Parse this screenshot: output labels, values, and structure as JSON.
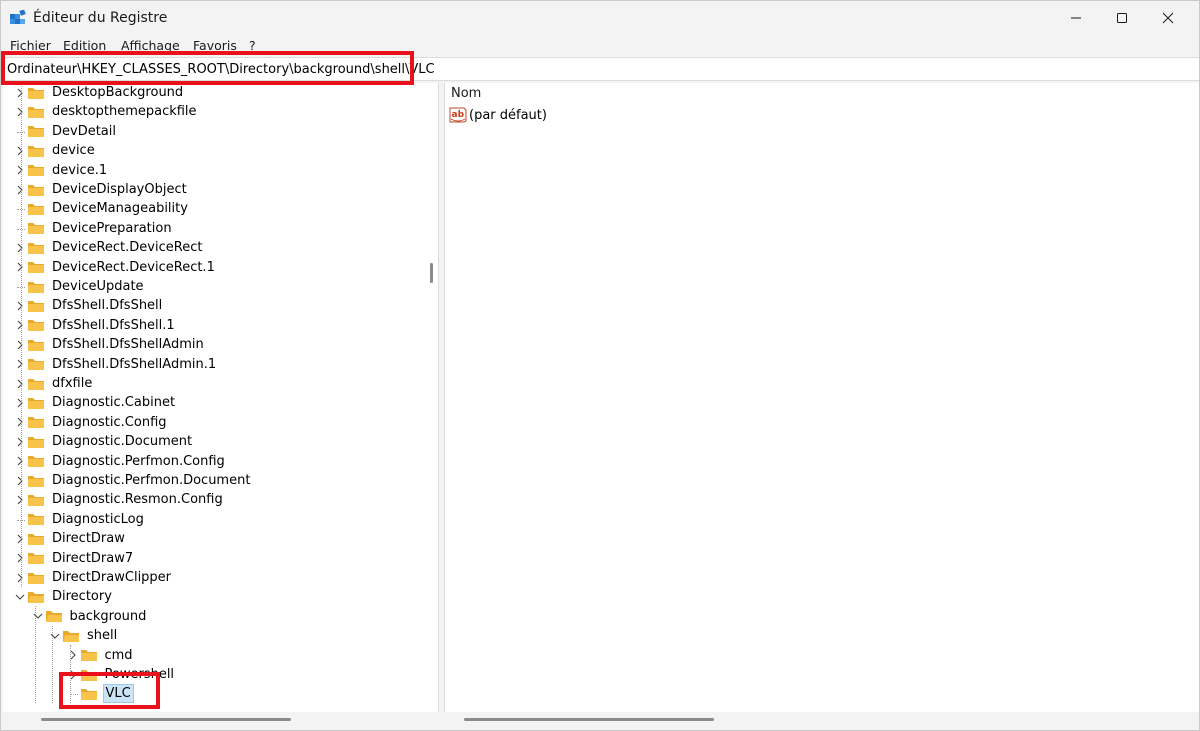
{
  "window": {
    "title": "Éditeur du Registre",
    "icons": {
      "app": "registry-editor-icon",
      "minimize": "minimize-icon",
      "maximize": "maximize-icon",
      "close": "close-icon"
    }
  },
  "menu": [
    "Fichier",
    "Edition",
    "Affichage",
    "Favoris",
    "?"
  ],
  "address": {
    "path": "Ordinateur\\HKEY_CLASSES_ROOT\\Directory\\background\\shell\\VLC"
  },
  "tree": {
    "items": [
      {
        "label": "DesktopBackground",
        "expandable": true,
        "expanded": false,
        "level": 0
      },
      {
        "label": "desktopthemepackfile",
        "expandable": true,
        "expanded": false,
        "level": 0
      },
      {
        "label": "DevDetail",
        "expandable": false,
        "expanded": false,
        "level": 0
      },
      {
        "label": "device",
        "expandable": true,
        "expanded": false,
        "level": 0
      },
      {
        "label": "device.1",
        "expandable": true,
        "expanded": false,
        "level": 0
      },
      {
        "label": "DeviceDisplayObject",
        "expandable": true,
        "expanded": false,
        "level": 0
      },
      {
        "label": "DeviceManageability",
        "expandable": false,
        "expanded": false,
        "level": 0
      },
      {
        "label": "DevicePreparation",
        "expandable": false,
        "expanded": false,
        "level": 0
      },
      {
        "label": "DeviceRect.DeviceRect",
        "expandable": true,
        "expanded": false,
        "level": 0
      },
      {
        "label": "DeviceRect.DeviceRect.1",
        "expandable": true,
        "expanded": false,
        "level": 0
      },
      {
        "label": "DeviceUpdate",
        "expandable": false,
        "expanded": false,
        "level": 0
      },
      {
        "label": "DfsShell.DfsShell",
        "expandable": true,
        "expanded": false,
        "level": 0
      },
      {
        "label": "DfsShell.DfsShell.1",
        "expandable": true,
        "expanded": false,
        "level": 0
      },
      {
        "label": "DfsShell.DfsShellAdmin",
        "expandable": true,
        "expanded": false,
        "level": 0
      },
      {
        "label": "DfsShell.DfsShellAdmin.1",
        "expandable": true,
        "expanded": false,
        "level": 0
      },
      {
        "label": "dfxfile",
        "expandable": true,
        "expanded": false,
        "level": 0
      },
      {
        "label": "Diagnostic.Cabinet",
        "expandable": true,
        "expanded": false,
        "level": 0
      },
      {
        "label": "Diagnostic.Config",
        "expandable": true,
        "expanded": false,
        "level": 0
      },
      {
        "label": "Diagnostic.Document",
        "expandable": true,
        "expanded": false,
        "level": 0
      },
      {
        "label": "Diagnostic.Perfmon.Config",
        "expandable": true,
        "expanded": false,
        "level": 0
      },
      {
        "label": "Diagnostic.Perfmon.Document",
        "expandable": true,
        "expanded": false,
        "level": 0
      },
      {
        "label": "Diagnostic.Resmon.Config",
        "expandable": true,
        "expanded": false,
        "level": 0
      },
      {
        "label": "DiagnosticLog",
        "expandable": false,
        "expanded": false,
        "level": 0
      },
      {
        "label": "DirectDraw",
        "expandable": true,
        "expanded": false,
        "level": 0
      },
      {
        "label": "DirectDraw7",
        "expandable": true,
        "expanded": false,
        "level": 0
      },
      {
        "label": "DirectDrawClipper",
        "expandable": true,
        "expanded": false,
        "level": 0
      },
      {
        "label": "Directory",
        "expandable": true,
        "expanded": true,
        "level": 0
      },
      {
        "label": "background",
        "expandable": true,
        "expanded": true,
        "level": 1
      },
      {
        "label": "shell",
        "expandable": true,
        "expanded": true,
        "level": 2
      },
      {
        "label": "cmd",
        "expandable": true,
        "expanded": false,
        "level": 3
      },
      {
        "label": "Powershell",
        "expandable": true,
        "expanded": false,
        "level": 3
      },
      {
        "label": "VLC",
        "expandable": false,
        "expanded": false,
        "level": 3,
        "selected": true
      }
    ]
  },
  "list": {
    "column_name": "Nom",
    "values": [
      {
        "name": "(par défaut)",
        "icon": "string-value-ab-icon"
      }
    ]
  },
  "colors": {
    "highlight_box": "#e8111c",
    "selection": "#cce4f7",
    "folder": "#f8c34a"
  }
}
